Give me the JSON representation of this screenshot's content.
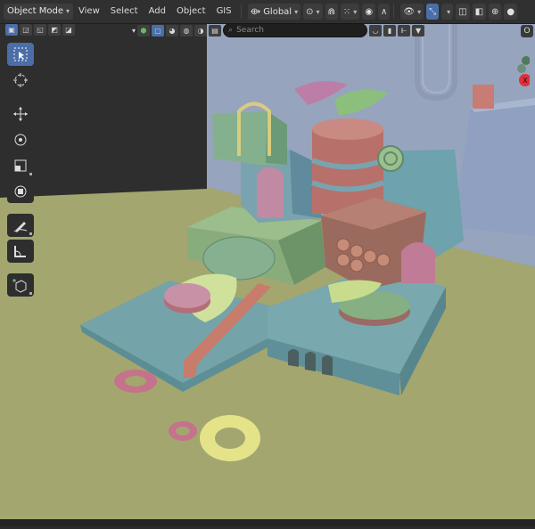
{
  "header": {
    "mode": "Object Mode",
    "menus": [
      "View",
      "Select",
      "Add",
      "Object",
      "GIS"
    ],
    "transform_orientation": "Global"
  },
  "search": {
    "placeholder": "Search"
  },
  "toolbar": {
    "tools": [
      "select-box",
      "cursor",
      "move",
      "rotate",
      "scale",
      "transform",
      "annotate",
      "measure",
      "add-cube"
    ],
    "active_tool": "select-box"
  },
  "gizmo": {
    "x_label": "X"
  },
  "corner": {
    "label": "O"
  },
  "colors": {
    "accent": "#4a6ea8",
    "ground": "#a3a66e",
    "sky": "#9aa7bf",
    "teal": "#6ea2a8",
    "green": "#7fa780",
    "salmon": "#b7706a",
    "pink": "#c07b97",
    "lime": "#c8dc8a",
    "gizmo_x": "#e0303e"
  }
}
